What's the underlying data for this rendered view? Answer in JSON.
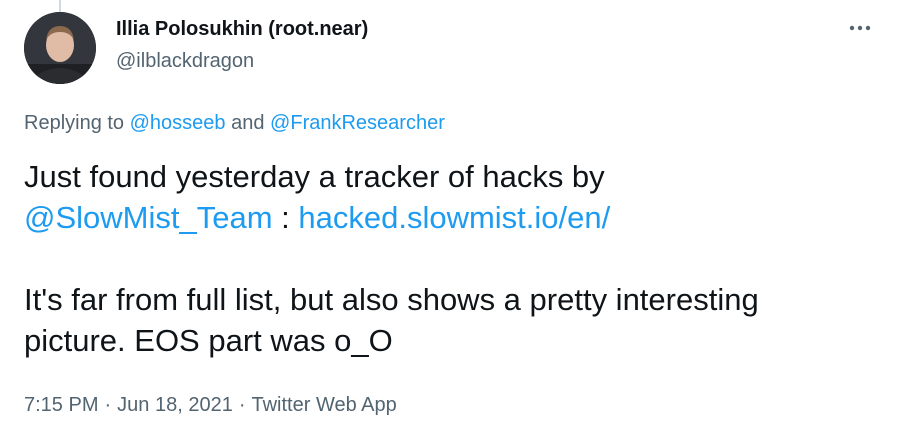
{
  "author": {
    "display_name": "Illia Polosukhin (root.near)",
    "handle": "@ilblackdragon",
    "avatar_icon": "user-avatar"
  },
  "header": {
    "more_icon": "more-horizontal-icon"
  },
  "reply_context": {
    "prefix": "Replying to",
    "user1": "@hosseeb",
    "conjunction": "and",
    "user2": "@FrankResearcher"
  },
  "tweet": {
    "line1": "Just found yesterday a tracker of hacks by",
    "mention": "@SlowMist_Team",
    "separator": " : ",
    "link": "hacked.slowmist.io/en/",
    "line3": "It's far from full list, but also shows a pretty interesting",
    "line4": "picture. EOS part was o_O"
  },
  "meta": {
    "time": "7:15 PM",
    "dot": "·",
    "date": "Jun 18, 2021",
    "source": "Twitter Web App"
  },
  "colors": {
    "link": "#1d9bf0",
    "secondary_text": "#536471",
    "primary_text": "#0f1419",
    "thread_line": "#cfd9de"
  }
}
